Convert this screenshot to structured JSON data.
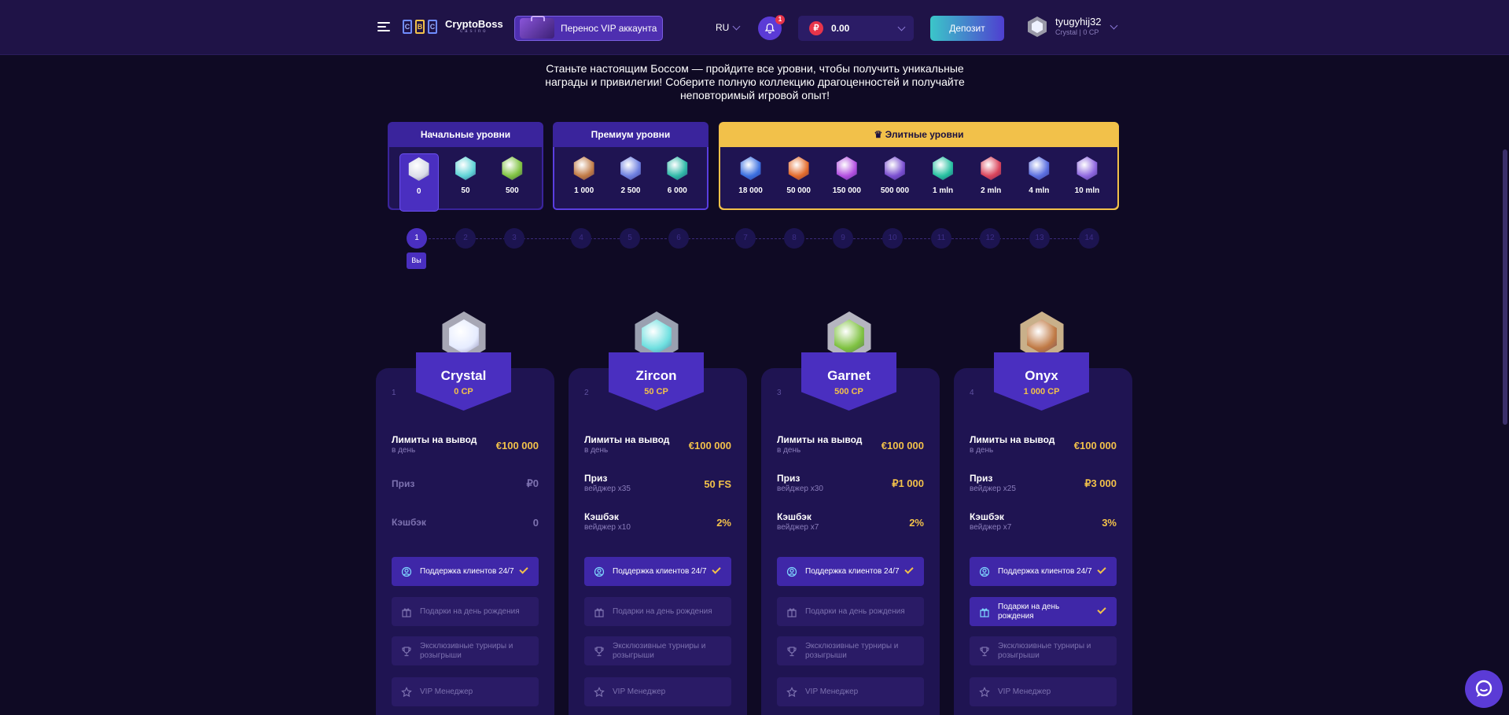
{
  "header": {
    "logo_text": "CryptoBoss",
    "logo_sub": "casino",
    "logo_letters": [
      "C",
      "B",
      "C"
    ],
    "vip_transfer": "Перенос VIP аккаунта",
    "lang": "RU",
    "notifications_count": "1",
    "currency_symbol": "₽",
    "balance": "0.00",
    "deposit": "Депозит",
    "user_name": "tyugyhij32",
    "user_level": "Crystal",
    "user_cp": "0 CP"
  },
  "intro": "Станьте настоящим Боссом — пройдите все уровни, чтобы получить уникальные награды и привилегии! Соберите полную коллекцию драгоценностей и получайте неповторимый игровой опыт!",
  "tiers": {
    "start": {
      "title": "Начальные уровни",
      "gems": [
        {
          "value": "0",
          "color": "#d9dce8"
        },
        {
          "value": "50",
          "color": "#5fd3d6"
        },
        {
          "value": "500",
          "color": "#7fc241"
        }
      ]
    },
    "premium": {
      "title": "Премиум уровни",
      "gems": [
        {
          "value": "1 000",
          "color": "#c07a45"
        },
        {
          "value": "2 500",
          "color": "#6d7fe0"
        },
        {
          "value": "6 000",
          "color": "#2fb9a8"
        }
      ]
    },
    "elite": {
      "title": "Элитные уровни",
      "crown": "♛",
      "gems": [
        {
          "value": "18 000",
          "color": "#3a6fe0"
        },
        {
          "value": "50 000",
          "color": "#e26a2a"
        },
        {
          "value": "150 000",
          "color": "#b24fe0"
        },
        {
          "value": "500 000",
          "color": "#7a4fd0"
        },
        {
          "value": "1 mln",
          "color": "#26c0a0"
        },
        {
          "value": "2 mln",
          "color": "#d9435a"
        },
        {
          "value": "4 mln",
          "color": "#5b6fe0"
        },
        {
          "value": "10 mln",
          "color": "#8f68e0"
        }
      ]
    }
  },
  "steps": [
    "1",
    "2",
    "3",
    "4",
    "5",
    "6",
    "7",
    "8",
    "9",
    "10",
    "11",
    "12",
    "13",
    "14"
  ],
  "you_label": "Вы",
  "cards": [
    {
      "num": "1",
      "name": "Crystal",
      "cp": "0 CP",
      "gem_color": "#e6ecff",
      "medal_color": "#a7a7b5",
      "limits_label": "Лимиты на вывод",
      "limits_sub": "в день",
      "limits_val": "€100 000",
      "prize_label": "Приз",
      "prize_sub": "",
      "prize_val": "₽0",
      "cashback_label": "Кэшбэк",
      "cashback_sub": "",
      "cashback_val": "0",
      "features": [
        {
          "label": "Поддержка клиентов 24/7",
          "on": true,
          "icon": "support-icon"
        },
        {
          "label": "Подарки на день рождения",
          "on": false,
          "icon": "gift-icon"
        },
        {
          "label": "Эксклюзивные турниры и розыгрыши",
          "on": false,
          "icon": "trophy-icon"
        },
        {
          "label": "VIP Менеджер",
          "on": false,
          "icon": "star-icon"
        }
      ]
    },
    {
      "num": "2",
      "name": "Zircon",
      "cp": "50 CP",
      "gem_color": "#6fe0e0",
      "medal_color": "#9aa0b0",
      "limits_label": "Лимиты на вывод",
      "limits_sub": "в день",
      "limits_val": "€100 000",
      "prize_label": "Приз",
      "prize_sub": "вейджер x35",
      "prize_val": "50 FS",
      "cashback_label": "Кэшбэк",
      "cashback_sub": "вейджер x10",
      "cashback_val": "2%",
      "features": [
        {
          "label": "Поддержка клиентов 24/7",
          "on": true,
          "icon": "support-icon"
        },
        {
          "label": "Подарки на день рождения",
          "on": false,
          "icon": "gift-icon"
        },
        {
          "label": "Эксклюзивные турниры и розыгрыши",
          "on": false,
          "icon": "trophy-icon"
        },
        {
          "label": "VIP Менеджер",
          "on": false,
          "icon": "star-icon"
        }
      ]
    },
    {
      "num": "3",
      "name": "Garnet",
      "cp": "500 CP",
      "gem_color": "#7fc241",
      "medal_color": "#b5b5c0",
      "limits_label": "Лимиты на вывод",
      "limits_sub": "в день",
      "limits_val": "€100 000",
      "prize_label": "Приз",
      "prize_sub": "вейджер x30",
      "prize_val": "₽1 000",
      "cashback_label": "Кэшбэк",
      "cashback_sub": "вейджер x7",
      "cashback_val": "2%",
      "features": [
        {
          "label": "Поддержка клиентов 24/7",
          "on": true,
          "icon": "support-icon"
        },
        {
          "label": "Подарки на день рождения",
          "on": false,
          "icon": "gift-icon"
        },
        {
          "label": "Эксклюзивные турниры и розыгрыши",
          "on": false,
          "icon": "trophy-icon"
        },
        {
          "label": "VIP Менеджер",
          "on": false,
          "icon": "star-icon"
        }
      ]
    },
    {
      "num": "4",
      "name": "Onyx",
      "cp": "1 000 CP",
      "gem_color": "#c07a45",
      "medal_color": "#c9b08a",
      "limits_label": "Лимиты на вывод",
      "limits_sub": "в день",
      "limits_val": "€100 000",
      "prize_label": "Приз",
      "prize_sub": "вейджер x25",
      "prize_val": "₽3 000",
      "cashback_label": "Кэшбэк",
      "cashback_sub": "вейджер x7",
      "cashback_val": "3%",
      "features": [
        {
          "label": "Поддержка клиентов 24/7",
          "on": true,
          "icon": "support-icon"
        },
        {
          "label": "Подарки на день рождения",
          "on": true,
          "icon": "gift-icon"
        },
        {
          "label": "Эксклюзивные турниры и розыгрыши",
          "on": false,
          "icon": "trophy-icon"
        },
        {
          "label": "VIP Менеджер",
          "on": false,
          "icon": "star-icon"
        }
      ]
    }
  ]
}
